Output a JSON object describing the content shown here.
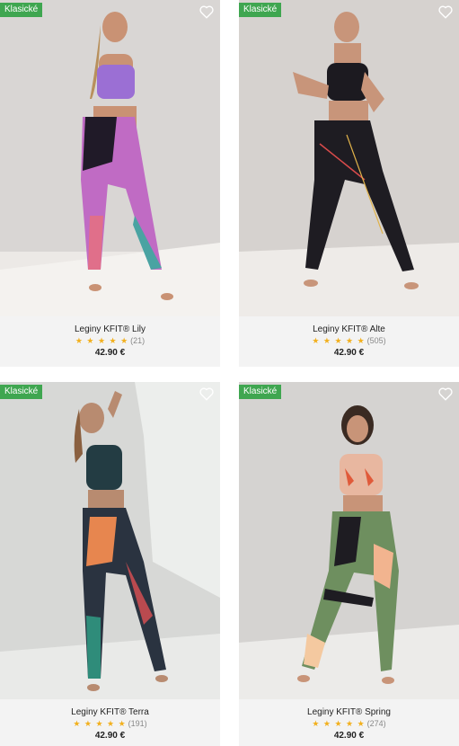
{
  "products": [
    {
      "badge": "Klasické",
      "name": "Leginy KFIT® Lily",
      "stars": "★ ★ ★ ★ ★",
      "reviews": "(21)",
      "price": "42.90 €"
    },
    {
      "badge": "Klasické",
      "name": "Leginy KFIT® Alte",
      "stars": "★ ★ ★ ★ ★",
      "reviews": "(505)",
      "price": "42.90 €"
    },
    {
      "badge": "Klasické",
      "name": "Leginy KFIT® Terra",
      "stars": "★ ★ ★ ★ ★",
      "reviews": "(191)",
      "price": "42.90 €"
    },
    {
      "badge": "Klasické",
      "name": "Leginy KFIT® Spring",
      "stars": "★ ★ ★ ★ ★",
      "reviews": "(274)",
      "price": "42.90 €"
    }
  ],
  "colors": {
    "badge_bg": "#3fa650",
    "star": "#f2b01e",
    "card_bg": "#f3f3f3"
  },
  "icons": {
    "favorite": "heart-outline-icon"
  }
}
